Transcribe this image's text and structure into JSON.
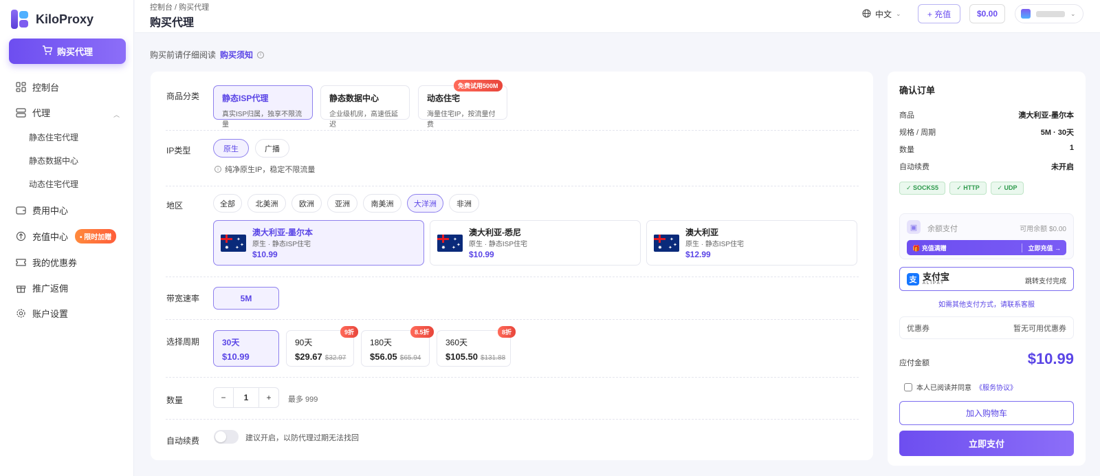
{
  "brand": {
    "name": "KiloProxy",
    "accent": "#6d4ef0"
  },
  "sidebar": {
    "buy_button": "购买代理",
    "items": [
      {
        "label": "控制台",
        "icon": "dashboard-icon"
      },
      {
        "label": "代理",
        "icon": "server-icon"
      },
      {
        "label": "费用中心",
        "icon": "wallet-icon"
      },
      {
        "label": "充值中心",
        "icon": "recharge-icon"
      },
      {
        "label": "我的优惠券",
        "icon": "ticket-icon"
      },
      {
        "label": "推广返佣",
        "icon": "gift-icon"
      },
      {
        "label": "账户设置",
        "icon": "gear-icon"
      }
    ],
    "sub_items": [
      "静态住宅代理",
      "静态数据中心",
      "动态住宅代理"
    ],
    "hot_badge": "• 限时加赠"
  },
  "header": {
    "breadcrumb": "控制台  /  购买代理",
    "title": "购买代理",
    "language": "中文",
    "recharge": "+ 充值",
    "balance": "$0.00"
  },
  "notice": {
    "text": "购买前请仔细阅读",
    "link": "购买须知"
  },
  "form": {
    "category_label": "商品分类",
    "categories": [
      {
        "title": "静态ISP代理",
        "desc": "真实ISP归属，独享不限流量"
      },
      {
        "title": "静态数据中心",
        "desc": "企业级机房，高速低延迟"
      },
      {
        "title": "动态住宅",
        "desc": "海量住宅IP，按流量付费"
      }
    ],
    "free_trial_tag": "免费试用500M",
    "ip_type_label": "IP类型",
    "ip_types": [
      "原生",
      "广播"
    ],
    "ip_hint": "纯净原生IP，稳定不限流量",
    "region_label": "地区",
    "continents": [
      "全部",
      "北美洲",
      "欧洲",
      "亚洲",
      "南美洲",
      "大洋洲",
      "非洲"
    ],
    "regions": [
      {
        "name": "澳大利亚-墨尔本",
        "desc": "原生 · 静态ISP住宅",
        "price": "$10.99"
      },
      {
        "name": "澳大利亚-悉尼",
        "desc": "原生 · 静态ISP住宅",
        "price": "$10.99"
      },
      {
        "name": "澳大利亚",
        "desc": "原生 · 静态ISP住宅",
        "price": "$12.99"
      }
    ],
    "bandwidth_label": "带宽速率",
    "bandwidth": "5M",
    "period_label": "选择周期",
    "periods": [
      {
        "days": "30天",
        "price": "$10.99",
        "orig": "",
        "discount": ""
      },
      {
        "days": "90天",
        "price": "$29.67",
        "orig": "$32.97",
        "discount": "9折"
      },
      {
        "days": "180天",
        "price": "$56.05",
        "orig": "$65.94",
        "discount": "8.5折"
      },
      {
        "days": "360天",
        "price": "$105.50",
        "orig": "$131.88",
        "discount": "8折"
      }
    ],
    "qty_label": "数量",
    "qty_minus": "−",
    "qty_value": "1",
    "qty_plus": "+",
    "qty_max": "最多 999",
    "auto_label": "自动续费",
    "auto_enabled": false,
    "auto_hint": "建议开启，以防代理过期无法找回"
  },
  "order": {
    "title": "确认订单",
    "rows": [
      {
        "k": "商品",
        "v": "澳大利亚-墨尔本"
      },
      {
        "k": "规格 / 周期",
        "v": "5M · 30天"
      },
      {
        "k": "数量",
        "v": "1"
      },
      {
        "k": "自动续费",
        "v": "未开启"
      }
    ],
    "protocols": [
      "✓ SOCKS5",
      "✓ HTTP",
      "✓ UDP"
    ],
    "balance_pay": "余额支付",
    "available": "可用余额 $0.00",
    "banner_left": "🎁 充值满赠",
    "banner_right": "立即充值 →",
    "alipay_name": "支付宝",
    "alipay_sub": "ALIPAY",
    "alipay_action": "跳转支付完成",
    "other_pay": "如需其他支付方式，请联系客服",
    "coupon_label": "优惠券",
    "coupon_value": "暂无可用优惠券",
    "pay_label": "应付金额",
    "pay_amount": "$10.99",
    "agree_text": "本人已阅读并同意",
    "agree_link": "《服务协议》",
    "cart_button": "加入购物车",
    "pay_button": "立即支付"
  }
}
